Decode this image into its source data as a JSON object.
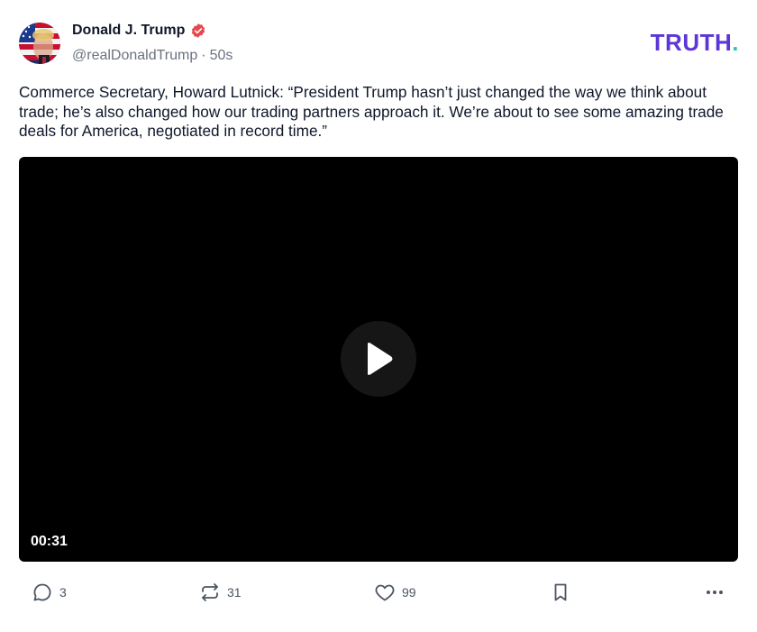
{
  "post": {
    "author": {
      "name": "Donald J. Trump",
      "handle": "@realDonaldTrump",
      "separator": "·",
      "time_ago": "50s",
      "verified": true
    },
    "brand": {
      "logo_text": "TRUTH",
      "logo_dot": ".",
      "logo_color": "#5d36d6",
      "dot_color": "#35c3ae"
    },
    "text": "Commerce Secretary, Howard Lutnick: “President Trump hasn’t just changed the way we think about trade; he’s also changed how our trading partners approach it. We’re about to see some amazing trade deals for America, negotiated in record time.”",
    "video": {
      "duration": "00:31",
      "play_icon": "play-icon"
    },
    "actions": {
      "replies": {
        "icon": "comment-icon",
        "count": "3"
      },
      "retruths": {
        "icon": "retruth-icon",
        "count": "31"
      },
      "likes": {
        "icon": "heart-icon",
        "count": "99"
      },
      "bookmark": {
        "icon": "bookmark-icon"
      },
      "more": {
        "icon": "more-icon"
      }
    },
    "colors": {
      "verified_badge": "#e5484d",
      "muted_text": "#6b7280",
      "action_icon": "#4b5563"
    }
  }
}
